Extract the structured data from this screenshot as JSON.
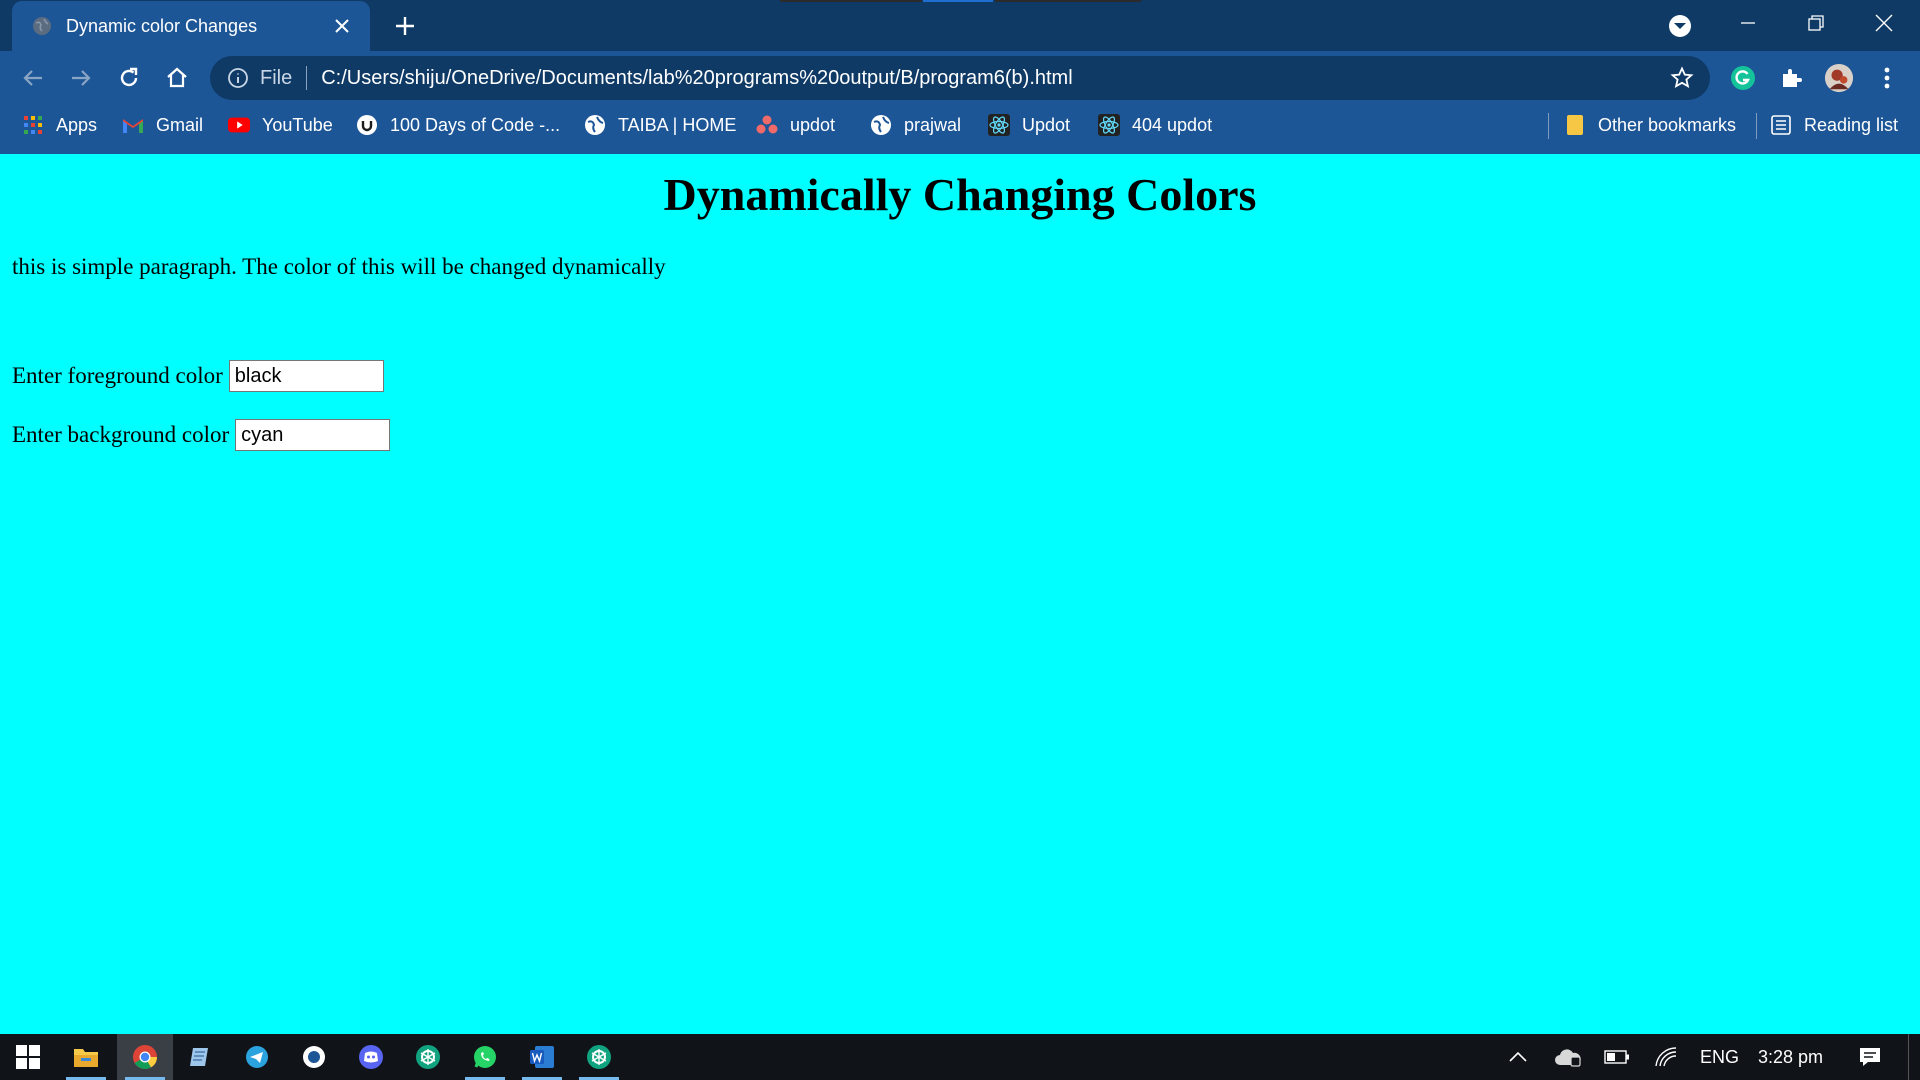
{
  "browser": {
    "tab_title": "Dynamic color Changes",
    "address_scheme": "File",
    "address_url": "C:/Users/shiju/OneDrive/Documents/lab%20programs%20output/B/program6(b).html"
  },
  "bookmarks": {
    "items": [
      {
        "label": "Apps",
        "icon": "apps-grid-icon"
      },
      {
        "label": "Gmail",
        "icon": "gmail-icon"
      },
      {
        "label": "YouTube",
        "icon": "youtube-icon"
      },
      {
        "label": "100 Days of Code -...",
        "icon": "udemy-icon"
      },
      {
        "label": "TAIBA | HOME",
        "icon": "globe-icon"
      },
      {
        "label": "updot",
        "icon": "asana-icon"
      },
      {
        "label": "prajwal",
        "icon": "globe-icon"
      },
      {
        "label": "Updot",
        "icon": "react-icon"
      },
      {
        "label": "404 updot",
        "icon": "react-icon"
      }
    ],
    "other_bookmarks": "Other bookmarks",
    "reading_list": "Reading list"
  },
  "page": {
    "heading": "Dynamically Changing Colors",
    "paragraph": "this is simple paragraph. The color of this will be changed dynamically",
    "foreground_label": "Enter foreground color",
    "foreground_value": "black",
    "background_label": "Enter background color",
    "background_value": "cyan"
  },
  "taskbar": {
    "language": "ENG",
    "time": "3:28 pm"
  },
  "colors": {
    "page_background": "#00ffff",
    "titlebar": "#0f3a66",
    "toolbar": "#1d5697",
    "taskbar": "#101418"
  }
}
